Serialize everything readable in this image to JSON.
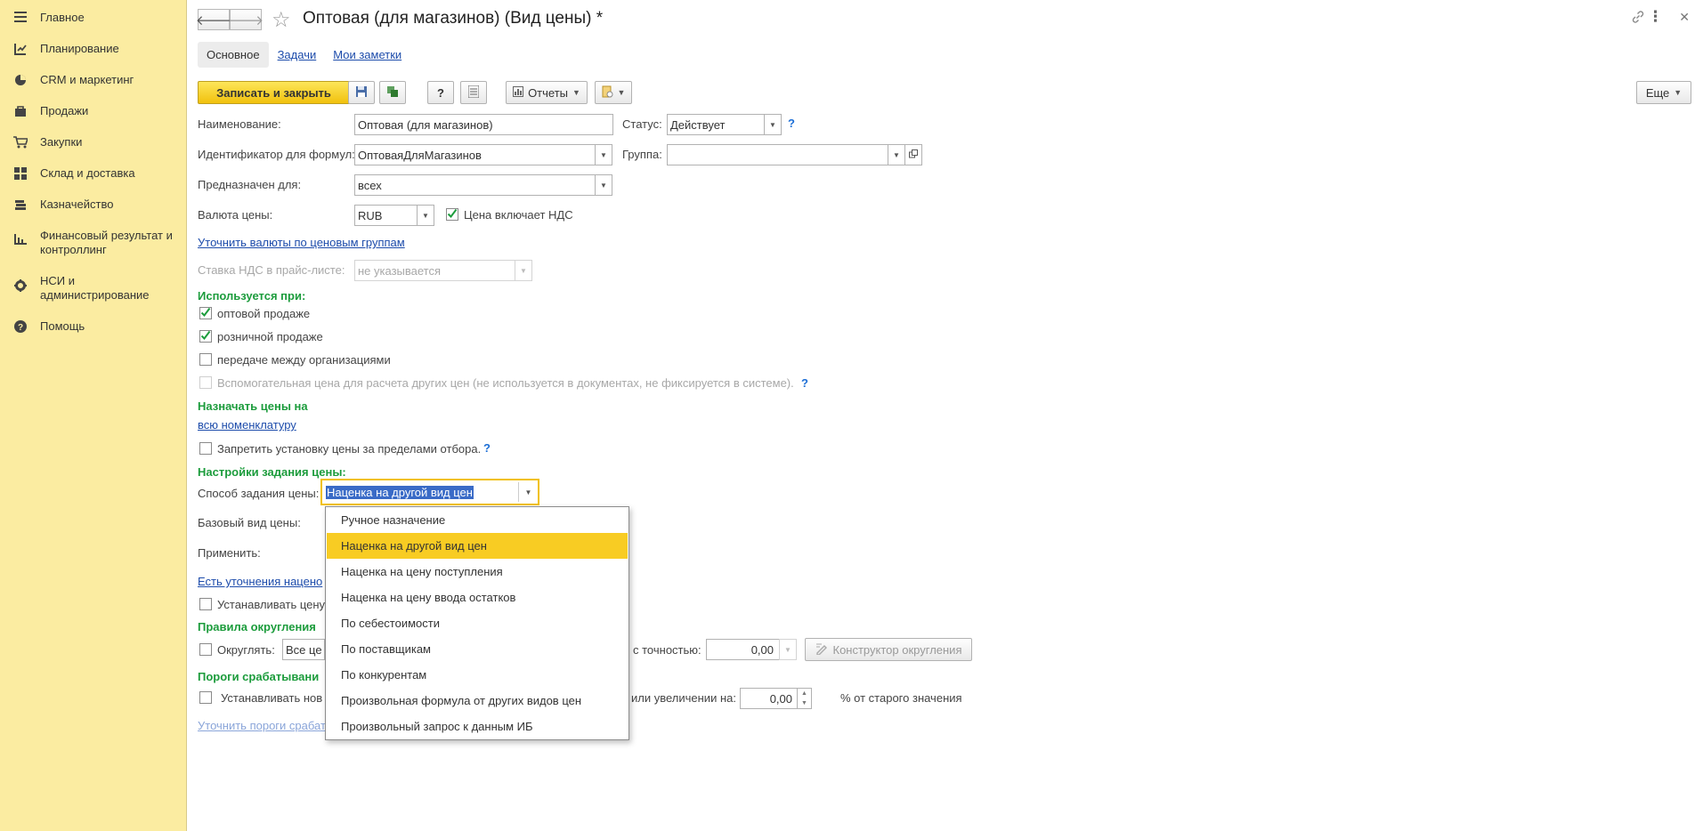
{
  "sidebar": {
    "items": [
      {
        "label": "Главное",
        "icon": "menu-icon"
      },
      {
        "label": "Планирование",
        "icon": "planning-icon"
      },
      {
        "label": "CRM и маркетинг",
        "icon": "pie-chart-icon"
      },
      {
        "label": "Продажи",
        "icon": "bag-icon"
      },
      {
        "label": "Закупки",
        "icon": "cart-icon"
      },
      {
        "label": "Склад и доставка",
        "icon": "warehouse-icon"
      },
      {
        "label": "Казначейство",
        "icon": "coins-icon"
      },
      {
        "label": "Финансовый результат и контроллинг",
        "icon": "bar-chart-icon"
      },
      {
        "label": "НСИ и администрирование",
        "icon": "gear-icon"
      },
      {
        "label": "Помощь",
        "icon": "help-icon"
      }
    ]
  },
  "header": {
    "title": "Оптовая (для магазинов) (Вид цены) *",
    "back_glyph": "🡐",
    "forward_glyph": "🡒",
    "star_glyph": "☆",
    "link_glyph": "🔗",
    "more_glyph": "⋮",
    "close_glyph": "✕"
  },
  "tabs": {
    "main": "Основное",
    "tasks": "Задачи",
    "notes": "Мои заметки"
  },
  "toolbar": {
    "save_close": "Записать и закрыть",
    "help_glyph": "?",
    "reports": "Отчеты",
    "more": "Еще"
  },
  "form": {
    "name_label": "Наименование:",
    "name_value": "Оптовая (для магазинов)",
    "status_label": "Статус:",
    "status_value": "Действует",
    "formula_id_label": "Идентификатор для формул:",
    "formula_id_value": "ОптоваяДляМагазинов",
    "group_label": "Группа:",
    "group_value": "",
    "intended_label": "Предназначен для:",
    "intended_value": "всех",
    "currency_label": "Валюта цены:",
    "currency_value": "RUB",
    "vat_included_label": "Цена включает НДС",
    "clarify_currency_link": "Уточнить валюты по ценовым группам",
    "vat_rate_label": "Ставка НДС в прайс-листе:",
    "vat_rate_value": "не указывается",
    "used_when_title": "Используется при:",
    "wholesale_label": "оптовой продаже",
    "retail_label": "розничной продаже",
    "transfer_label": "передаче между организациями",
    "auxiliary_label": "Вспомогательная цена для расчета других цен (не используется в документах, не фиксируется в системе).",
    "assign_title": "Назначать цены на",
    "all_items_link": "всю номенклатуру",
    "forbid_label": "Запретить установку цены за пределами отбора.",
    "settings_title": "Настройки задания цены:",
    "method_label": "Способ задания цены:",
    "method_value": "Наценка на другой вид цен",
    "base_price_label": "Базовый вид цены:",
    "apply_label": "Применить:",
    "markup_link": "Есть уточнения нацено",
    "set_price_label": "Устанавливать цену",
    "rounding_title": "Правила округления",
    "round_label": "Округлять:",
    "round_value": "Все це",
    "precision_label": "с точностью:",
    "precision_value": "0,00",
    "rounding_builder": "Конструктор округления",
    "thresholds_title": "Пороги срабатывани",
    "set_new_label": "Устанавливать нов",
    "increase_label": "или увеличении на:",
    "increase_value": "0,00",
    "percent_label": "% от старого значения",
    "clarify_thresholds_link": "Уточнить пороги срабат"
  },
  "dropdown": {
    "options": [
      "Ручное назначение",
      "Наценка на другой вид цен",
      "Наценка на цену поступления",
      "Наценка на цену ввода остатков",
      "По себестоимости",
      "По поставщикам",
      "По конкурентам",
      "Произвольная формула от других видов цен",
      "Произвольный запрос к данным ИБ"
    ],
    "selected": "Наценка на другой вид цен"
  },
  "colors": {
    "sidebar_bg": "#fbeca1",
    "accent_yellow": "#f8cc23",
    "section_green": "#1c9c3c",
    "link_blue": "#1d4cab"
  }
}
